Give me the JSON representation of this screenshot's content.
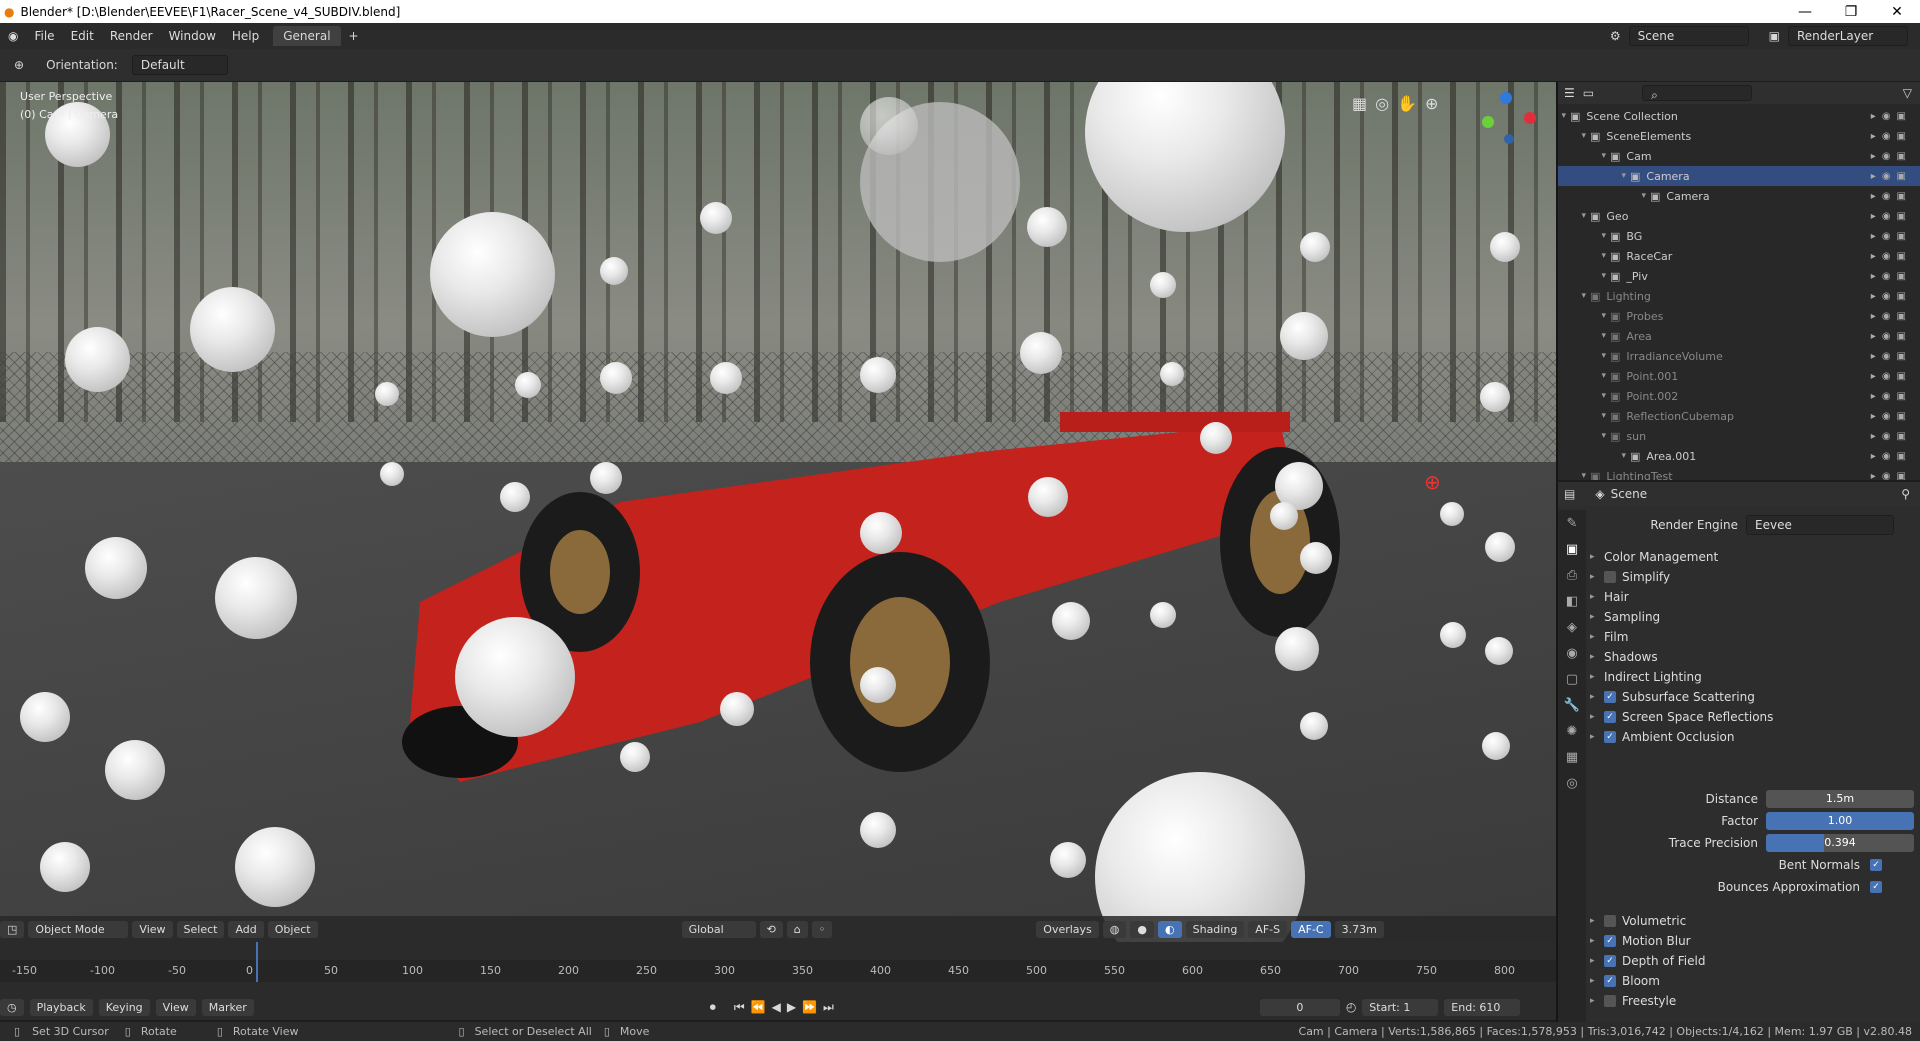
{
  "window": {
    "title": "Blender* [D:\\Blender\\EEVEE\\F1\\Racer_Scene_v4_SUBDIV.blend]",
    "min": "—",
    "max": "❐",
    "close": "✕"
  },
  "menu": {
    "items": [
      "File",
      "Edit",
      "Render",
      "Window",
      "Help"
    ],
    "tab": "General",
    "add": "+",
    "scene": "Scene",
    "renderlayer": "RenderLayer"
  },
  "header": {
    "orientation_label": "Orientation:",
    "orientation_value": "Default"
  },
  "viewport": {
    "perspective": "User Perspective",
    "collection": "(0) Cam | Camera",
    "footer": {
      "mode": "Object Mode",
      "view": "View",
      "select": "Select",
      "add": "Add",
      "object": "Object",
      "transform": "Global",
      "overlays": "Overlays",
      "shading": "Shading",
      "afs": "AF-S",
      "afc": "AF-C",
      "distance": "3.73m"
    }
  },
  "timeline": {
    "ticks": [
      "-150",
      "-100",
      "-50",
      "0",
      "50",
      "100",
      "150",
      "200",
      "250",
      "300",
      "350",
      "400",
      "450",
      "500",
      "550",
      "600",
      "650",
      "700",
      "750",
      "800"
    ],
    "playback": "Playback",
    "keying": "Keying",
    "view": "View",
    "marker": "Marker",
    "frame": "0",
    "start_label": "Start:",
    "start": "1",
    "end_label": "End:",
    "end": "610"
  },
  "status": {
    "set_cursor": "Set 3D Cursor",
    "rotate": "Rotate",
    "rotate_view": "Rotate View",
    "select": "Select or Deselect All",
    "move": "Move",
    "stats": "Cam | Camera | Verts:1,586,865 | Faces:1,578,953 | Tris:3,016,742 | Objects:1/4,162 | Mem: 1.97 GB | v2.80.48"
  },
  "outliner": {
    "rows": [
      {
        "label": "Scene Collection",
        "indent": 0,
        "dim": false,
        "sel": false
      },
      {
        "label": "SceneElements",
        "indent": 1,
        "dim": false,
        "sel": false
      },
      {
        "label": "Cam",
        "indent": 2,
        "dim": false,
        "sel": false
      },
      {
        "label": "Camera",
        "indent": 3,
        "dim": false,
        "sel": true
      },
      {
        "label": "Camera",
        "indent": 4,
        "dim": false,
        "sel": false
      },
      {
        "label": "Geo",
        "indent": 1,
        "dim": false,
        "sel": false
      },
      {
        "label": "BG",
        "indent": 2,
        "dim": false,
        "sel": false
      },
      {
        "label": "RaceCar",
        "indent": 2,
        "dim": false,
        "sel": false
      },
      {
        "label": "_Piv",
        "indent": 2,
        "dim": false,
        "sel": false
      },
      {
        "label": "Lighting",
        "indent": 1,
        "dim": true,
        "sel": false
      },
      {
        "label": "Probes",
        "indent": 2,
        "dim": true,
        "sel": false
      },
      {
        "label": "Area",
        "indent": 2,
        "dim": true,
        "sel": false
      },
      {
        "label": "IrradianceVolume",
        "indent": 2,
        "dim": true,
        "sel": false
      },
      {
        "label": "Point.001",
        "indent": 2,
        "dim": true,
        "sel": false
      },
      {
        "label": "Point.002",
        "indent": 2,
        "dim": true,
        "sel": false
      },
      {
        "label": "ReflectionCubemap",
        "indent": 2,
        "dim": true,
        "sel": false
      },
      {
        "label": "sun",
        "indent": 2,
        "dim": true,
        "sel": false
      },
      {
        "label": "Area.001",
        "indent": 3,
        "dim": false,
        "sel": false
      },
      {
        "label": "LightingTest",
        "indent": 1,
        "dim": true,
        "sel": false
      }
    ]
  },
  "properties": {
    "context": "Scene",
    "render_engine_label": "Render Engine",
    "render_engine": "Eevee",
    "sections": [
      {
        "label": "Color Management",
        "cb": null
      },
      {
        "label": "Simplify",
        "cb": false
      },
      {
        "label": "Hair",
        "cb": null
      },
      {
        "label": "Sampling",
        "cb": null
      },
      {
        "label": "Film",
        "cb": null
      },
      {
        "label": "Shadows",
        "cb": null
      },
      {
        "label": "Indirect Lighting",
        "cb": null
      },
      {
        "label": "Subsurface Scattering",
        "cb": true
      },
      {
        "label": "Screen Space Reflections",
        "cb": true
      },
      {
        "label": "Ambient Occlusion",
        "cb": true
      }
    ],
    "ao": {
      "distance_label": "Distance",
      "distance": "1.5m",
      "factor_label": "Factor",
      "factor": "1.00",
      "trace_label": "Trace Precision",
      "trace": "0.394",
      "trace_fill": 0.394,
      "bent_label": "Bent Normals",
      "bounces_label": "Bounces Approximation"
    },
    "sections2": [
      {
        "label": "Volumetric",
        "cb": false
      },
      {
        "label": "Motion Blur",
        "cb": true
      },
      {
        "label": "Depth of Field",
        "cb": true
      },
      {
        "label": "Bloom",
        "cb": true
      },
      {
        "label": "Freestyle",
        "cb": false
      }
    ]
  }
}
